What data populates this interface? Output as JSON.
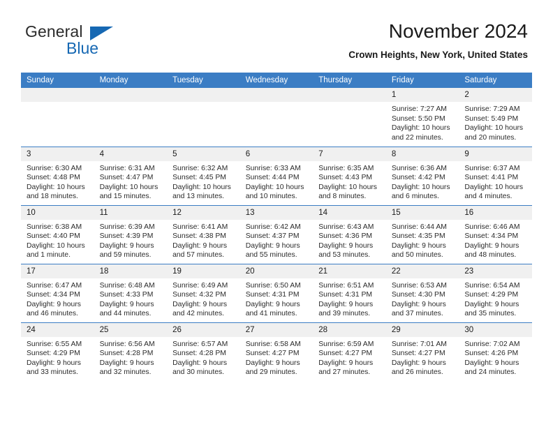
{
  "brand": {
    "name_part1": "General",
    "name_part2": "Blue",
    "triangle_color": "#1668b3"
  },
  "header": {
    "title": "November 2024",
    "subtitle": "Crown Heights, New York, United States"
  },
  "theme": {
    "header_blue": "#3b7dc4",
    "daynum_gray": "#f0f0f0"
  },
  "weekday_headers": [
    "Sunday",
    "Monday",
    "Tuesday",
    "Wednesday",
    "Thursday",
    "Friday",
    "Saturday"
  ],
  "labels": {
    "sunrise_prefix": "Sunrise:",
    "sunset_prefix": "Sunset:",
    "daylight_prefix": "Daylight:"
  },
  "weeks": [
    [
      {
        "day": "",
        "empty": true
      },
      {
        "day": "",
        "empty": true
      },
      {
        "day": "",
        "empty": true
      },
      {
        "day": "",
        "empty": true
      },
      {
        "day": "",
        "empty": true
      },
      {
        "day": "1",
        "sunrise": "Sunrise: 7:27 AM",
        "sunset": "Sunset: 5:50 PM",
        "daylight": "Daylight: 10 hours and 22 minutes."
      },
      {
        "day": "2",
        "sunrise": "Sunrise: 7:29 AM",
        "sunset": "Sunset: 5:49 PM",
        "daylight": "Daylight: 10 hours and 20 minutes."
      }
    ],
    [
      {
        "day": "3",
        "sunrise": "Sunrise: 6:30 AM",
        "sunset": "Sunset: 4:48 PM",
        "daylight": "Daylight: 10 hours and 18 minutes."
      },
      {
        "day": "4",
        "sunrise": "Sunrise: 6:31 AM",
        "sunset": "Sunset: 4:47 PM",
        "daylight": "Daylight: 10 hours and 15 minutes."
      },
      {
        "day": "5",
        "sunrise": "Sunrise: 6:32 AM",
        "sunset": "Sunset: 4:45 PM",
        "daylight": "Daylight: 10 hours and 13 minutes."
      },
      {
        "day": "6",
        "sunrise": "Sunrise: 6:33 AM",
        "sunset": "Sunset: 4:44 PM",
        "daylight": "Daylight: 10 hours and 10 minutes."
      },
      {
        "day": "7",
        "sunrise": "Sunrise: 6:35 AM",
        "sunset": "Sunset: 4:43 PM",
        "daylight": "Daylight: 10 hours and 8 minutes."
      },
      {
        "day": "8",
        "sunrise": "Sunrise: 6:36 AM",
        "sunset": "Sunset: 4:42 PM",
        "daylight": "Daylight: 10 hours and 6 minutes."
      },
      {
        "day": "9",
        "sunrise": "Sunrise: 6:37 AM",
        "sunset": "Sunset: 4:41 PM",
        "daylight": "Daylight: 10 hours and 4 minutes."
      }
    ],
    [
      {
        "day": "10",
        "sunrise": "Sunrise: 6:38 AM",
        "sunset": "Sunset: 4:40 PM",
        "daylight": "Daylight: 10 hours and 1 minute."
      },
      {
        "day": "11",
        "sunrise": "Sunrise: 6:39 AM",
        "sunset": "Sunset: 4:39 PM",
        "daylight": "Daylight: 9 hours and 59 minutes."
      },
      {
        "day": "12",
        "sunrise": "Sunrise: 6:41 AM",
        "sunset": "Sunset: 4:38 PM",
        "daylight": "Daylight: 9 hours and 57 minutes."
      },
      {
        "day": "13",
        "sunrise": "Sunrise: 6:42 AM",
        "sunset": "Sunset: 4:37 PM",
        "daylight": "Daylight: 9 hours and 55 minutes."
      },
      {
        "day": "14",
        "sunrise": "Sunrise: 6:43 AM",
        "sunset": "Sunset: 4:36 PM",
        "daylight": "Daylight: 9 hours and 53 minutes."
      },
      {
        "day": "15",
        "sunrise": "Sunrise: 6:44 AM",
        "sunset": "Sunset: 4:35 PM",
        "daylight": "Daylight: 9 hours and 50 minutes."
      },
      {
        "day": "16",
        "sunrise": "Sunrise: 6:46 AM",
        "sunset": "Sunset: 4:34 PM",
        "daylight": "Daylight: 9 hours and 48 minutes."
      }
    ],
    [
      {
        "day": "17",
        "sunrise": "Sunrise: 6:47 AM",
        "sunset": "Sunset: 4:34 PM",
        "daylight": "Daylight: 9 hours and 46 minutes."
      },
      {
        "day": "18",
        "sunrise": "Sunrise: 6:48 AM",
        "sunset": "Sunset: 4:33 PM",
        "daylight": "Daylight: 9 hours and 44 minutes."
      },
      {
        "day": "19",
        "sunrise": "Sunrise: 6:49 AM",
        "sunset": "Sunset: 4:32 PM",
        "daylight": "Daylight: 9 hours and 42 minutes."
      },
      {
        "day": "20",
        "sunrise": "Sunrise: 6:50 AM",
        "sunset": "Sunset: 4:31 PM",
        "daylight": "Daylight: 9 hours and 41 minutes."
      },
      {
        "day": "21",
        "sunrise": "Sunrise: 6:51 AM",
        "sunset": "Sunset: 4:31 PM",
        "daylight": "Daylight: 9 hours and 39 minutes."
      },
      {
        "day": "22",
        "sunrise": "Sunrise: 6:53 AM",
        "sunset": "Sunset: 4:30 PM",
        "daylight": "Daylight: 9 hours and 37 minutes."
      },
      {
        "day": "23",
        "sunrise": "Sunrise: 6:54 AM",
        "sunset": "Sunset: 4:29 PM",
        "daylight": "Daylight: 9 hours and 35 minutes."
      }
    ],
    [
      {
        "day": "24",
        "sunrise": "Sunrise: 6:55 AM",
        "sunset": "Sunset: 4:29 PM",
        "daylight": "Daylight: 9 hours and 33 minutes."
      },
      {
        "day": "25",
        "sunrise": "Sunrise: 6:56 AM",
        "sunset": "Sunset: 4:28 PM",
        "daylight": "Daylight: 9 hours and 32 minutes."
      },
      {
        "day": "26",
        "sunrise": "Sunrise: 6:57 AM",
        "sunset": "Sunset: 4:28 PM",
        "daylight": "Daylight: 9 hours and 30 minutes."
      },
      {
        "day": "27",
        "sunrise": "Sunrise: 6:58 AM",
        "sunset": "Sunset: 4:27 PM",
        "daylight": "Daylight: 9 hours and 29 minutes."
      },
      {
        "day": "28",
        "sunrise": "Sunrise: 6:59 AM",
        "sunset": "Sunset: 4:27 PM",
        "daylight": "Daylight: 9 hours and 27 minutes."
      },
      {
        "day": "29",
        "sunrise": "Sunrise: 7:01 AM",
        "sunset": "Sunset: 4:27 PM",
        "daylight": "Daylight: 9 hours and 26 minutes."
      },
      {
        "day": "30",
        "sunrise": "Sunrise: 7:02 AM",
        "sunset": "Sunset: 4:26 PM",
        "daylight": "Daylight: 9 hours and 24 minutes."
      }
    ]
  ]
}
